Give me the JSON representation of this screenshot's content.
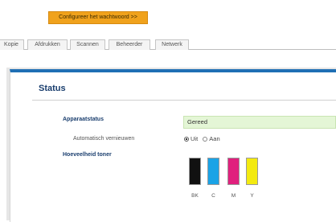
{
  "password_button": {
    "label": "Configureer het wachtwoord >>"
  },
  "tabs": [
    {
      "label": "Kopie"
    },
    {
      "label": "Afdrukken"
    },
    {
      "label": "Scannen"
    },
    {
      "label": "Beheerder"
    },
    {
      "label": "Netwerk"
    }
  ],
  "status": {
    "title": "Status",
    "device_status_label": "Apparaatstatus",
    "device_status_value": "Gereed",
    "auto_refresh_label": "Automatisch vernieuwen",
    "auto_refresh_options": [
      {
        "label": "Uit",
        "selected": true
      },
      {
        "label": "Aan",
        "selected": false
      }
    ],
    "toner_label": "Hoeveelheid toner",
    "toners": [
      {
        "label": "BK",
        "color": "#111111"
      },
      {
        "label": "C",
        "color": "#1aa3e6"
      },
      {
        "label": "M",
        "color": "#e0207d"
      },
      {
        "label": "Y",
        "color": "#f3ea10"
      }
    ]
  }
}
